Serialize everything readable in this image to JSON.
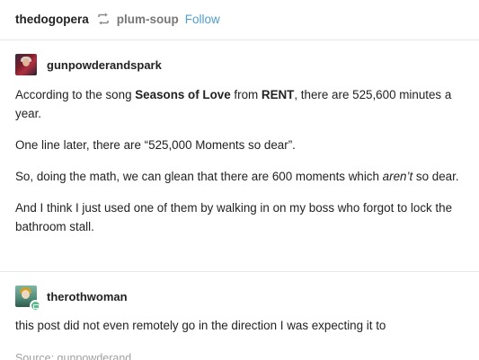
{
  "header": {
    "poster": "thedogopera",
    "reblog_icon": "reblog-icon",
    "source": "plum-soup",
    "follow_label": "Follow"
  },
  "reblogs": [
    {
      "username": "gunpowderandspark",
      "avatar": "avatar",
      "paragraphs": {
        "p1": {
          "t1": "According to the song ",
          "b1": "Seasons of Love",
          "t2": " from ",
          "b2": "RENT",
          "t3": ", there are 525,600 minutes a year."
        },
        "p2": "One line later, there are “525,000 Moments so dear”.",
        "p3": {
          "t1": "So, doing the math, we can glean that there are 600 moments which ",
          "i1": "aren’t",
          "t2": " so dear."
        },
        "p4": "And I think I just used one of them by walking in on my boss who forgot to lock the bathroom stall."
      }
    },
    {
      "username": "therothwoman",
      "avatar": "avatar",
      "badge_icon": "chat-badge-icon",
      "text": "this post did not even remotely go in the direction I was expecting it to"
    }
  ],
  "footer": {
    "source_text": "Source:  gunpowderand"
  }
}
